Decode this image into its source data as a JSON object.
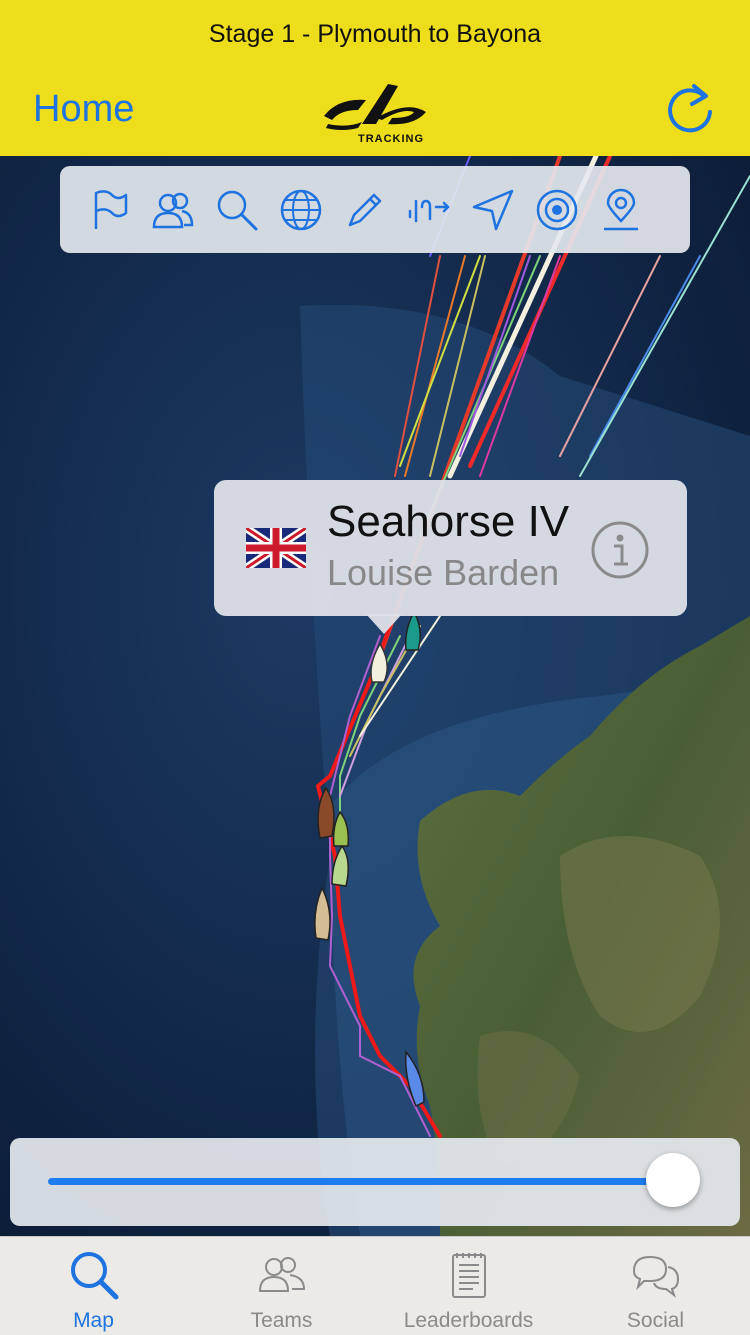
{
  "header": {
    "title": "Stage 1 - Plymouth to Bayona",
    "home_label": "Home",
    "logo_text": "TRACKING",
    "accent_color": "#eedd1a",
    "link_color": "#1e73e0"
  },
  "toolbar": {
    "icons": [
      "flag-icon",
      "people-icon",
      "search-icon",
      "globe-icon",
      "pencil-icon",
      "wind-icon",
      "navigation-arrow-icon",
      "target-icon",
      "map-pin-icon"
    ]
  },
  "callout": {
    "boat_name": "Seahorse IV",
    "skipper": "Louise Barden",
    "flag": "united-kingdom-flag-icon"
  },
  "timeline": {
    "position": 1.0
  },
  "tabbar": {
    "tabs": [
      {
        "label": "Map",
        "icon": "search-icon",
        "active": true
      },
      {
        "label": "Teams",
        "icon": "people-icon",
        "active": false
      },
      {
        "label": "Leaderboards",
        "icon": "notepad-icon",
        "active": false
      },
      {
        "label": "Social",
        "icon": "chat-bubbles-icon",
        "active": false
      }
    ]
  }
}
